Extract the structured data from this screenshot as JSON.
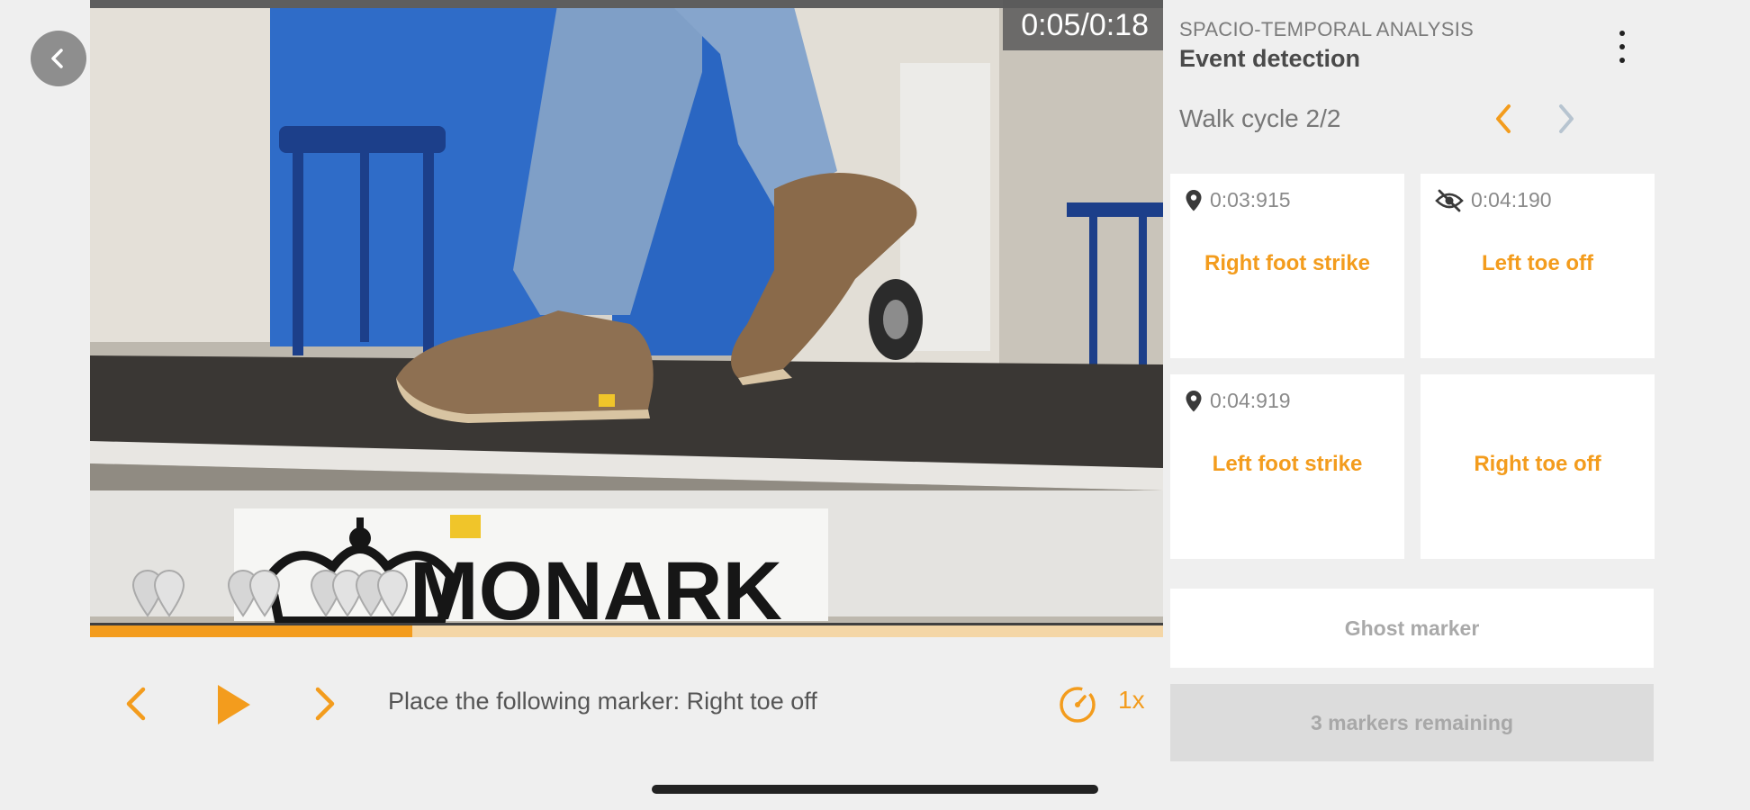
{
  "video": {
    "timecode": "0:05/0:18",
    "progress_fraction": 0.3,
    "marker_pins": 4
  },
  "controls": {
    "instruction": "Place the following marker: Right toe off",
    "speed": "1x"
  },
  "panel": {
    "subtitle": "SPACIO-TEMPORAL ANALYSIS",
    "title": "Event detection",
    "cycle_label": "Walk cycle 2/2"
  },
  "events": [
    {
      "time": "0:03:915",
      "label": "Right foot strike",
      "icon": "location-pin-icon"
    },
    {
      "time": "0:04:190",
      "label": "Left toe off",
      "icon": "eye-off-icon"
    },
    {
      "time": "0:04:919",
      "label": "Left foot strike",
      "icon": "location-pin-icon"
    },
    {
      "time": "",
      "label": "Right toe off",
      "icon": ""
    }
  ],
  "buttons": {
    "ghost_marker": "Ghost marker",
    "remaining": "3 markers remaining"
  },
  "colors": {
    "accent": "#f39c1d",
    "panel_background": "#efefef",
    "card_background": "#ffffff",
    "nav_disabled": "#b7c4d0"
  }
}
